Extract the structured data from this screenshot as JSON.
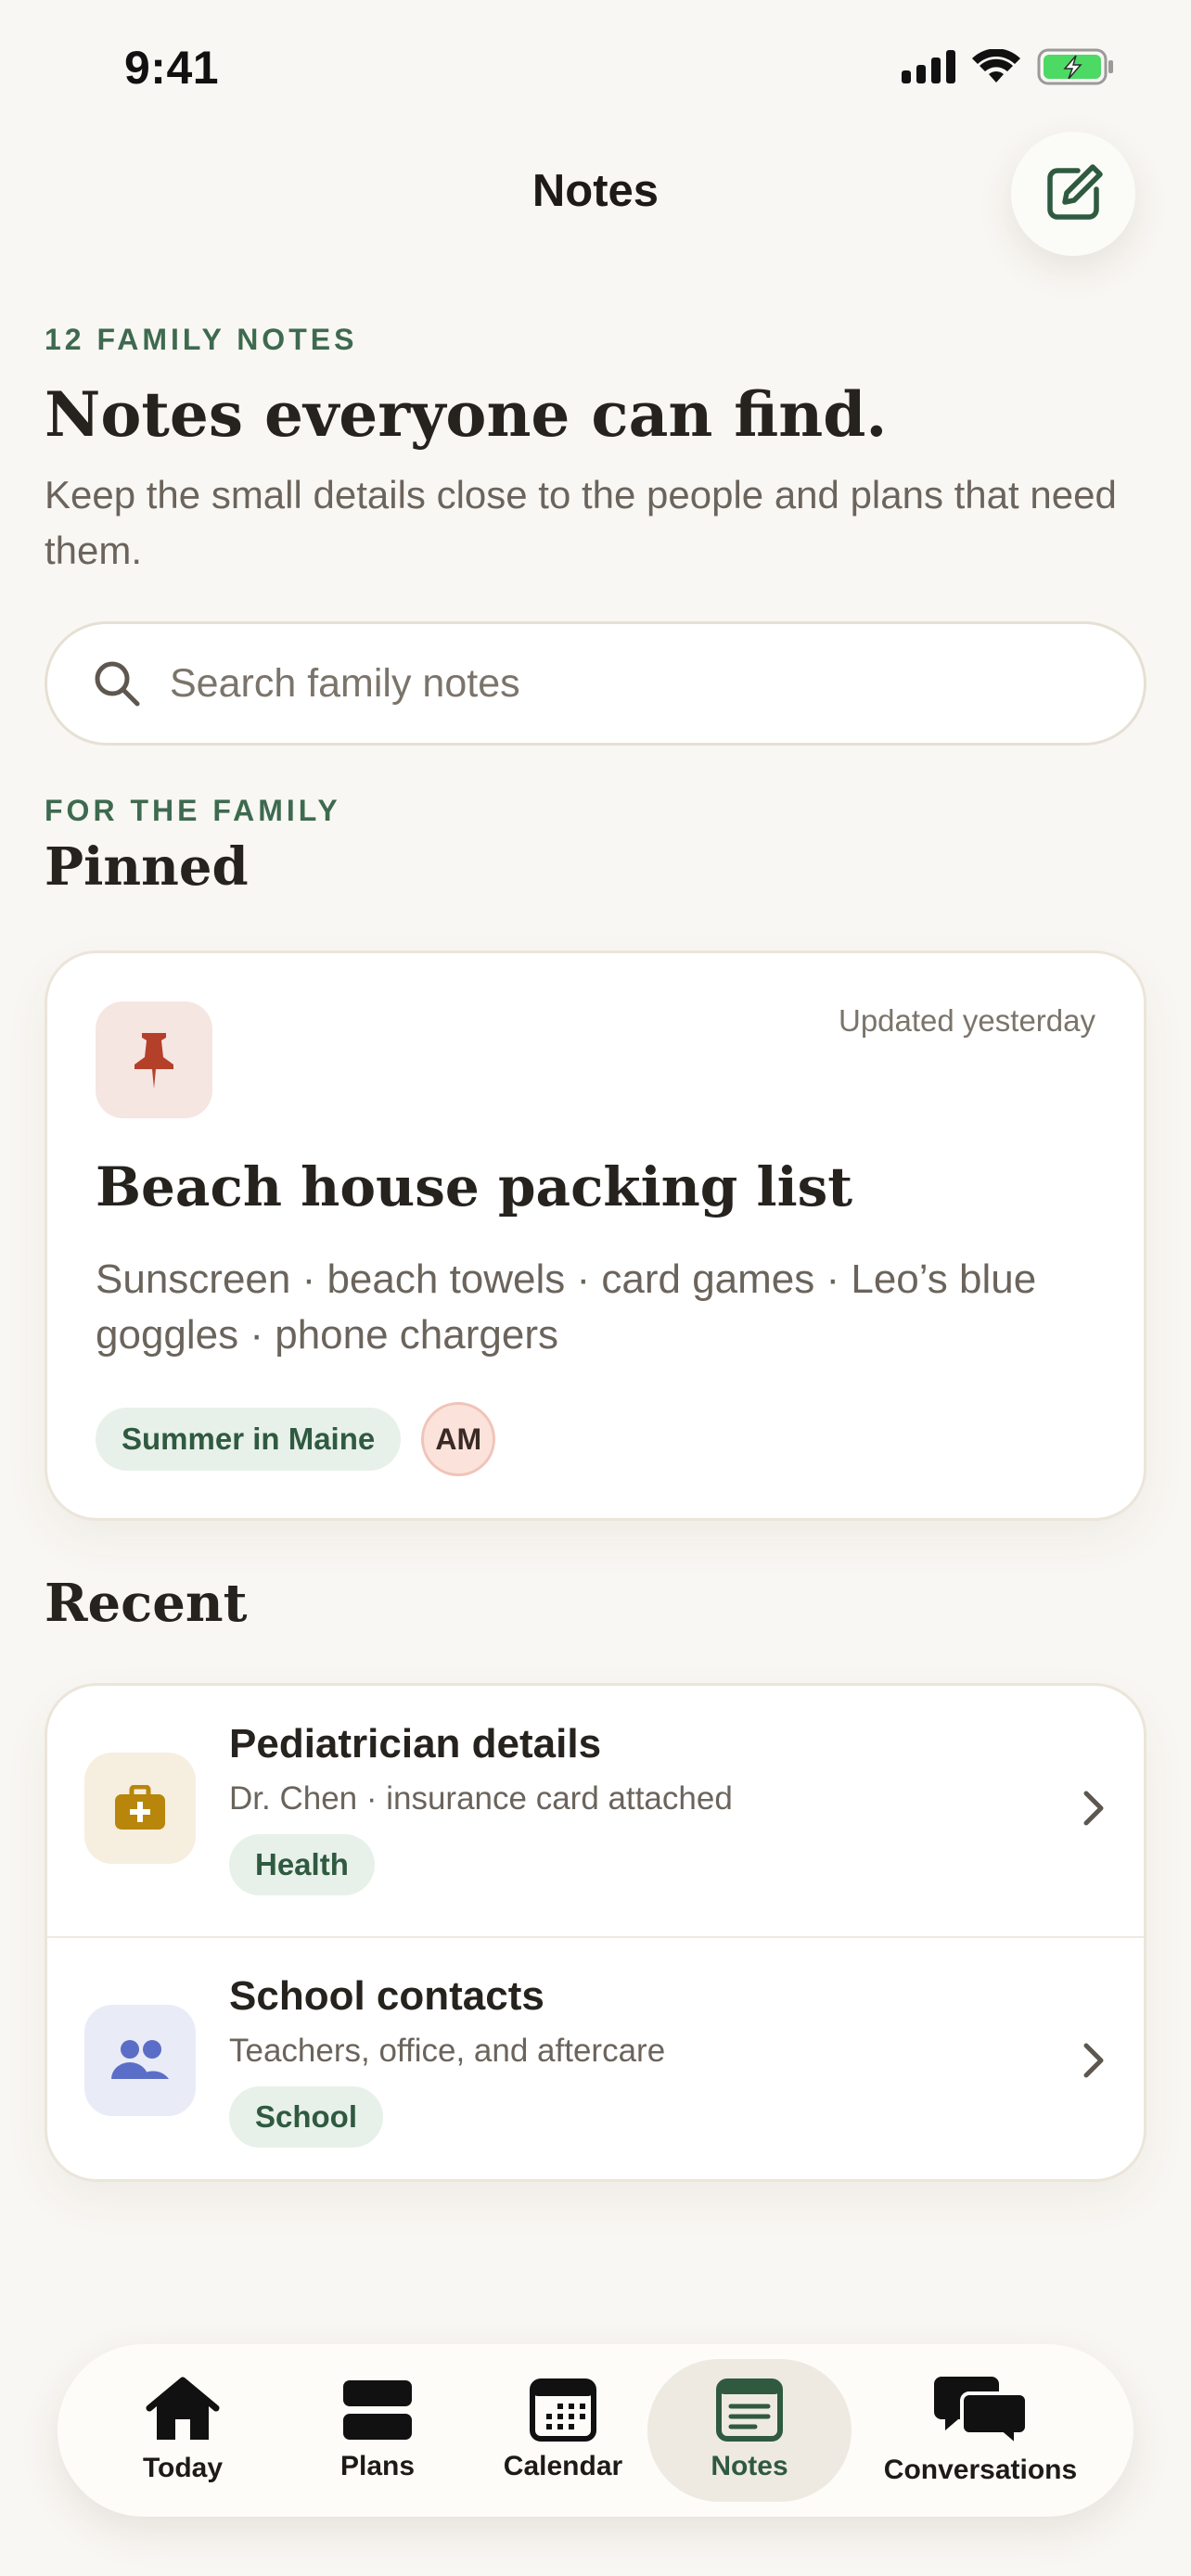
{
  "status": {
    "time": "9:41"
  },
  "nav": {
    "title": "Notes"
  },
  "hero": {
    "eyebrow": "12 FAMILY NOTES",
    "title": "Notes everyone can find.",
    "subtitle": "Keep the small details close to the people and plans that need them."
  },
  "search": {
    "placeholder": "Search family notes"
  },
  "pinned_section": {
    "eyebrow": "FOR THE FAMILY",
    "title": "Pinned",
    "card": {
      "updated": "Updated yesterday",
      "title": "Beach house packing list",
      "body": "Sunscreen · beach towels · card games · Leo’s blue goggles · phone chargers",
      "tag": "Summer in Maine",
      "avatar_initials": "AM"
    }
  },
  "recent_section": {
    "title": "Recent",
    "items": [
      {
        "title": "Pediatrician details",
        "subtitle": "Dr. Chen · insurance card attached",
        "tag": "Health",
        "icon": "medical-kit-icon"
      },
      {
        "title": "School contacts",
        "subtitle": "Teachers, office, and aftercare",
        "tag": "School",
        "icon": "people-icon"
      }
    ]
  },
  "tabbar": {
    "tabs": [
      {
        "label": "Today",
        "icon": "home-icon"
      },
      {
        "label": "Plans",
        "icon": "plans-icon"
      },
      {
        "label": "Calendar",
        "icon": "calendar-icon"
      },
      {
        "label": "Notes",
        "icon": "notes-icon",
        "active": true
      },
      {
        "label": "Conversations",
        "icon": "chat-bubbles-icon"
      }
    ]
  },
  "colors": {
    "background": "#f9f7f3",
    "accent_green": "#3e6a4f",
    "battery_green": "#4cd964",
    "pin_red": "#b5402a",
    "health_gold": "#b8860b",
    "school_blue": "#5b6ec7"
  }
}
